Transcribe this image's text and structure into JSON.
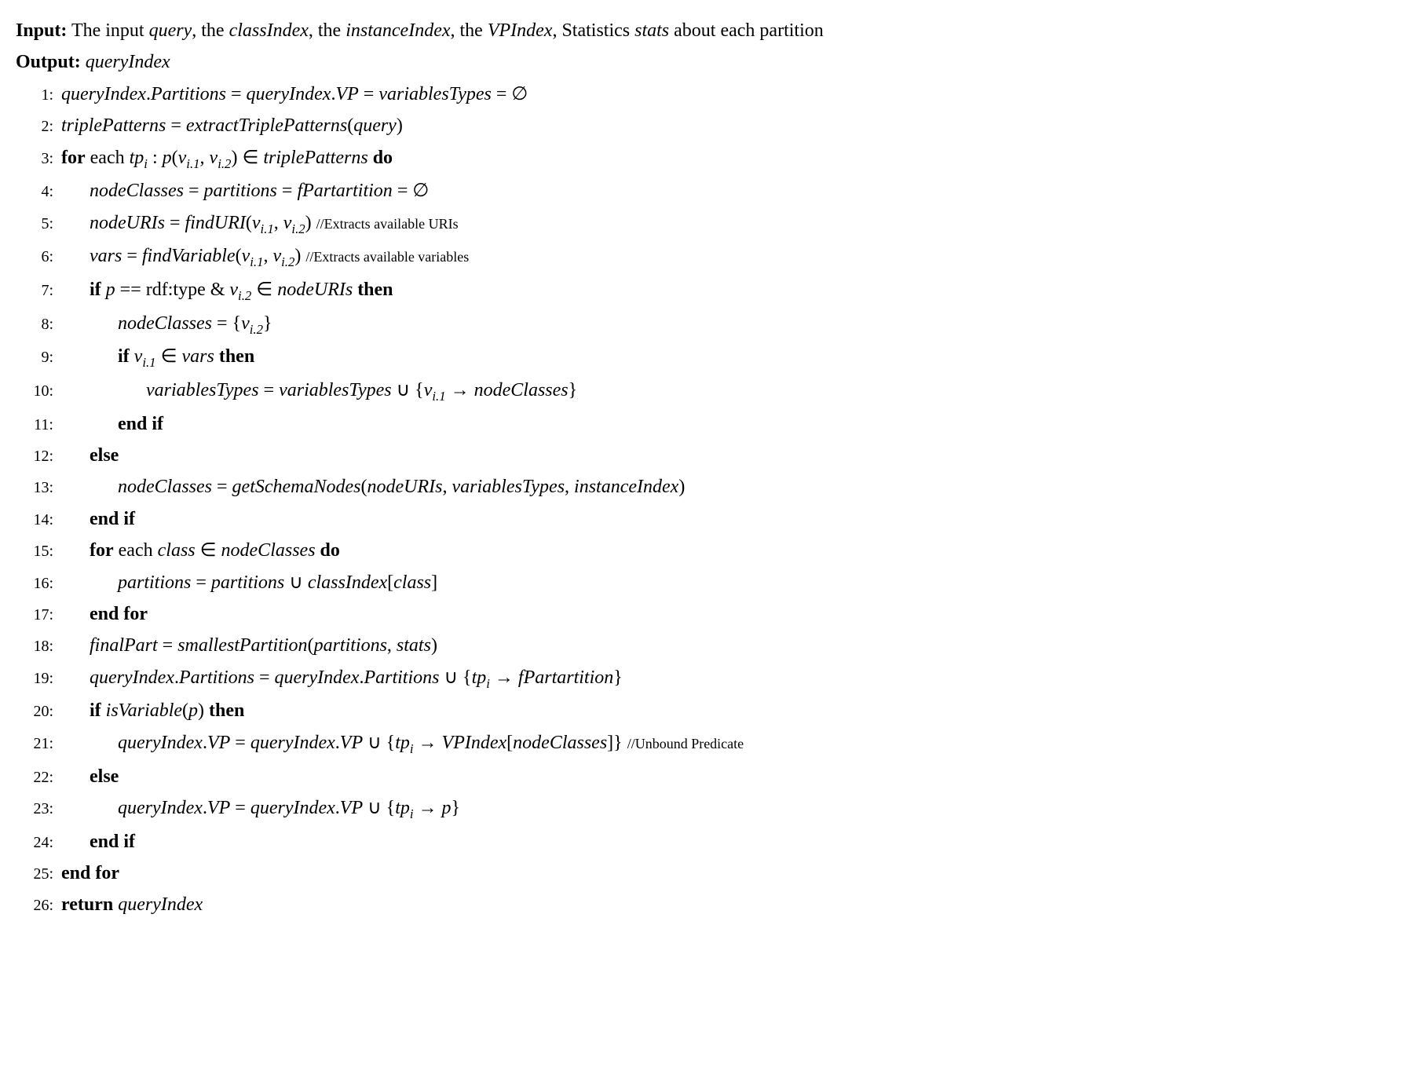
{
  "header": {
    "input_label": "Input:",
    "input_text_1": "The input ",
    "input_query": "query",
    "input_text_2": ", the ",
    "input_classIndex": "classIndex",
    "input_text_3": ", the ",
    "input_instanceIndex": "instanceIndex",
    "input_text_4": ", the ",
    "input_VPIndex": "VPIndex",
    "input_text_5": ", Statistics ",
    "input_stats": "stats",
    "input_text_6": " about each partition",
    "output_label": "Output:",
    "output_value": "queryIndex"
  },
  "lines": {
    "l1": {
      "a": "queryIndex",
      "b": ".",
      "c": "Partitions",
      "d": " = ",
      "e": "queryIndex",
      "f": ".",
      "g": "VP",
      "h": " = ",
      "i": "variablesTypes",
      "j": " = ∅"
    },
    "l2": {
      "a": "triplePatterns",
      "b": " = ",
      "c": "extractTriplePatterns",
      "d": "(",
      "e": "query",
      "f": ")"
    },
    "l3": {
      "for": "for",
      "each": " each ",
      "tp": "tp",
      "sub_i": "i",
      "colon": " : ",
      "p": "p",
      "lp": "(",
      "v1": "v",
      "sub_i1": "i.1",
      "comma": ", ",
      "v2": "v",
      "sub_i2": "i.2",
      "rp": ") ∈ ",
      "tpset": "triplePatterns",
      "do": " do"
    },
    "l4": {
      "a": "nodeClasses",
      "b": " = ",
      "c": "partitions",
      "d": " = ",
      "e": "fPartartition",
      "f": " = ∅"
    },
    "l5": {
      "a": "nodeURIs",
      "b": " = ",
      "c": "findURI",
      "d": "(",
      "v1": "v",
      "sub_i1": "i.1",
      "comma": ", ",
      "v2": "v",
      "sub_i2": "i.2",
      "e": ") ",
      "comment": "//Extracts available URIs"
    },
    "l6": {
      "a": "vars",
      "b": " = ",
      "c": "findVariable",
      "d": "(",
      "v1": "v",
      "sub_i1": "i.1",
      "comma": ", ",
      "v2": "v",
      "sub_i2": "i.2",
      "e": ") ",
      "comment": "//Extracts available variables"
    },
    "l7": {
      "if": "if ",
      "p": "p",
      "eq": " == ",
      "rdf": "rdf:type & ",
      "v2": "v",
      "sub_i2": "i.2",
      "in": " ∈ ",
      "uris": "nodeURIs",
      "then": " then"
    },
    "l8": {
      "a": "nodeClasses",
      "b": " = {",
      "v2": "v",
      "sub_i2": "i.2",
      "c": "}"
    },
    "l9": {
      "if": "if ",
      "v1": "v",
      "sub_i1": "i.1",
      "in": " ∈ ",
      "vars": "vars",
      "then": " then"
    },
    "l10": {
      "a": "variablesTypes",
      "b": " = ",
      "c": "variablesTypes",
      "d": " ∪ {",
      "v1": "v",
      "sub_i1": "i.1",
      "e": " → ",
      "f": "nodeClasses",
      "g": "}"
    },
    "l11": {
      "a": "end if"
    },
    "l12": {
      "a": "else"
    },
    "l13": {
      "a": "nodeClasses",
      "b": " = ",
      "c": "getSchemaNodes",
      "d": "(",
      "e": "nodeURIs",
      "f": ", ",
      "g": "variablesTypes",
      "h": ", ",
      "i": "instanceIndex",
      "j": ")"
    },
    "l14": {
      "a": "end if"
    },
    "l15": {
      "for": "for",
      "each": " each ",
      "class": "class",
      "in": " ∈ ",
      "nc": "nodeClasses",
      "do": " do"
    },
    "l16": {
      "a": "partitions",
      "b": " = ",
      "c": "partitions",
      "d": " ∪ ",
      "e": "classIndex",
      "f": "[",
      "g": "class",
      "h": "]"
    },
    "l17": {
      "a": "end for"
    },
    "l18": {
      "a": "finalPart",
      "b": " = ",
      "c": "smallestPartition",
      "d": "(",
      "e": "partitions",
      "f": ", ",
      "g": "stats",
      "h": ")"
    },
    "l19": {
      "a": "queryIndex",
      "b": ".",
      "c": "Partitions",
      "d": " = ",
      "e": "queryIndex",
      "f": ".",
      "g": "Partitions",
      "h": " ∪ {",
      "tp": "tp",
      "sub_i": "i",
      "i": " → ",
      "j": "fPartartition",
      "k": "}"
    },
    "l20": {
      "if": "if ",
      "a": "isVariable",
      "b": "(",
      "p": "p",
      "c": ")",
      "then": " then"
    },
    "l21": {
      "a": "queryIndex",
      "b": ".",
      "c": "VP",
      "d": " = ",
      "e": "queryIndex",
      "f": ".",
      "g": "VP",
      "h": " ∪ {",
      "tp": "tp",
      "sub_i": "i",
      "i": " → ",
      "j": "VPIndex",
      "k": "[",
      "l": "nodeClasses",
      "m": "]} ",
      "comment": "//Unbound Predicate"
    },
    "l22": {
      "a": "else"
    },
    "l23": {
      "a": "queryIndex",
      "b": ".",
      "c": "VP",
      "d": " = ",
      "e": "queryIndex",
      "f": ".",
      "g": "VP",
      "h": " ∪ {",
      "tp": "tp",
      "sub_i": "i",
      "i": " → ",
      "p": "p",
      "j": "}"
    },
    "l24": {
      "a": "end if"
    },
    "l25": {
      "a": "end for"
    },
    "l26": {
      "a": "return ",
      "b": "queryIndex"
    }
  },
  "line_numbers": {
    "n1": "1:",
    "n2": "2:",
    "n3": "3:",
    "n4": "4:",
    "n5": "5:",
    "n6": "6:",
    "n7": "7:",
    "n8": "8:",
    "n9": "9:",
    "n10": "10:",
    "n11": "11:",
    "n12": "12:",
    "n13": "13:",
    "n14": "14:",
    "n15": "15:",
    "n16": "16:",
    "n17": "17:",
    "n18": "18:",
    "n19": "19:",
    "n20": "20:",
    "n21": "21:",
    "n22": "22:",
    "n23": "23:",
    "n24": "24:",
    "n25": "25:",
    "n26": "26:"
  }
}
